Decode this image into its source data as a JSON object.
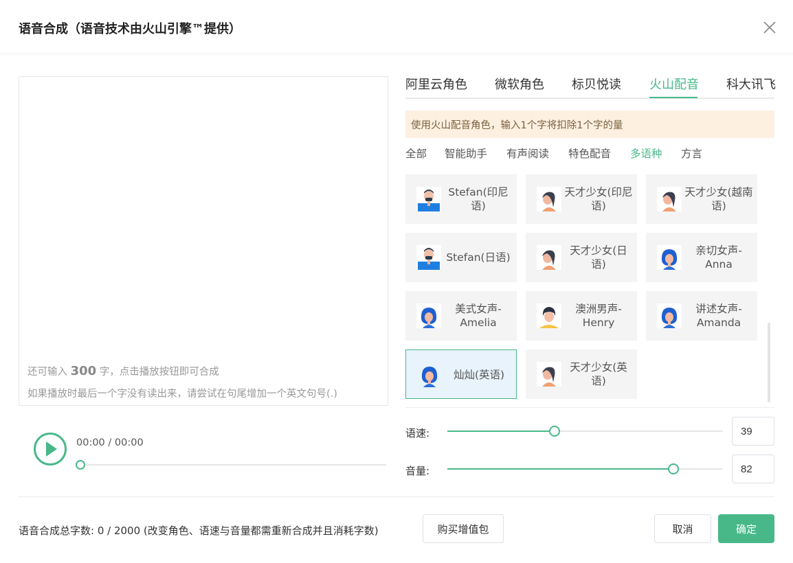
{
  "dialog": {
    "title": "语音合成（语音技术由火山引擎™提供）"
  },
  "editor": {
    "placeholder": "",
    "remaining_prefix": "还可输入 ",
    "remaining_count": "300",
    "remaining_suffix": " 字，点击播放按钮即可合成",
    "hint": "如果播放时最后一个字没有读出来，请尝试在句尾增加一个英文句号(.)"
  },
  "player": {
    "time": "00:00 / 00:00",
    "progress": 0
  },
  "tabs": [
    "阿里云角色",
    "微软角色",
    "标贝悦读",
    "火山配音",
    "科大讯飞"
  ],
  "active_tab": "火山配音",
  "notice": "使用火山配音角色，输入1个字将扣除1个字的量",
  "categories": [
    "全部",
    "智能助手",
    "有声阅读",
    "特色配音",
    "多语种",
    "方言"
  ],
  "active_category": "多语种",
  "voices": [
    {
      "label": "Stefan(印尼语)",
      "avatar": "male-avatar-icon"
    },
    {
      "label": "天才少女(印尼语)",
      "avatar": "girl-avatar-icon"
    },
    {
      "label": "天才少女(越南语)",
      "avatar": "girl-avatar-icon"
    },
    {
      "label": "Stefan(日语)",
      "avatar": "male-avatar-icon"
    },
    {
      "label": "天才少女(日语)",
      "avatar": "girl-avatar-icon"
    },
    {
      "label": "亲切女声-Anna",
      "avatar": "woman-avatar-icon"
    },
    {
      "label": "美式女声-Amelia",
      "avatar": "woman-avatar-icon"
    },
    {
      "label": "澳洲男声-Henry",
      "avatar": "boy-avatar-icon"
    },
    {
      "label": "讲述女声-Amanda",
      "avatar": "woman-avatar-icon"
    },
    {
      "label": "灿灿(英语)",
      "avatar": "woman-avatar-icon"
    },
    {
      "label": "天才少女(英语)",
      "avatar": "girl-avatar-icon"
    }
  ],
  "selected_voice": "灿灿(英语)",
  "speed": {
    "label": "语速:",
    "value": "39",
    "min": 0,
    "max": 100
  },
  "volume": {
    "label": "音量:",
    "value": "82",
    "min": 0,
    "max": 100
  },
  "footer": {
    "summary": "语音合成总字数:  0 / 2000  (改变角色、语速与音量都需重新合成并且消耗字数)",
    "buy_label": "购买增值包",
    "cancel_label": "取消",
    "confirm_label": "确定"
  },
  "colors": {
    "accent": "#48b889",
    "notice_bg": "#fdf0e0",
    "card_bg": "#f4f4f5",
    "selected_bg": "#e8f3fb"
  }
}
